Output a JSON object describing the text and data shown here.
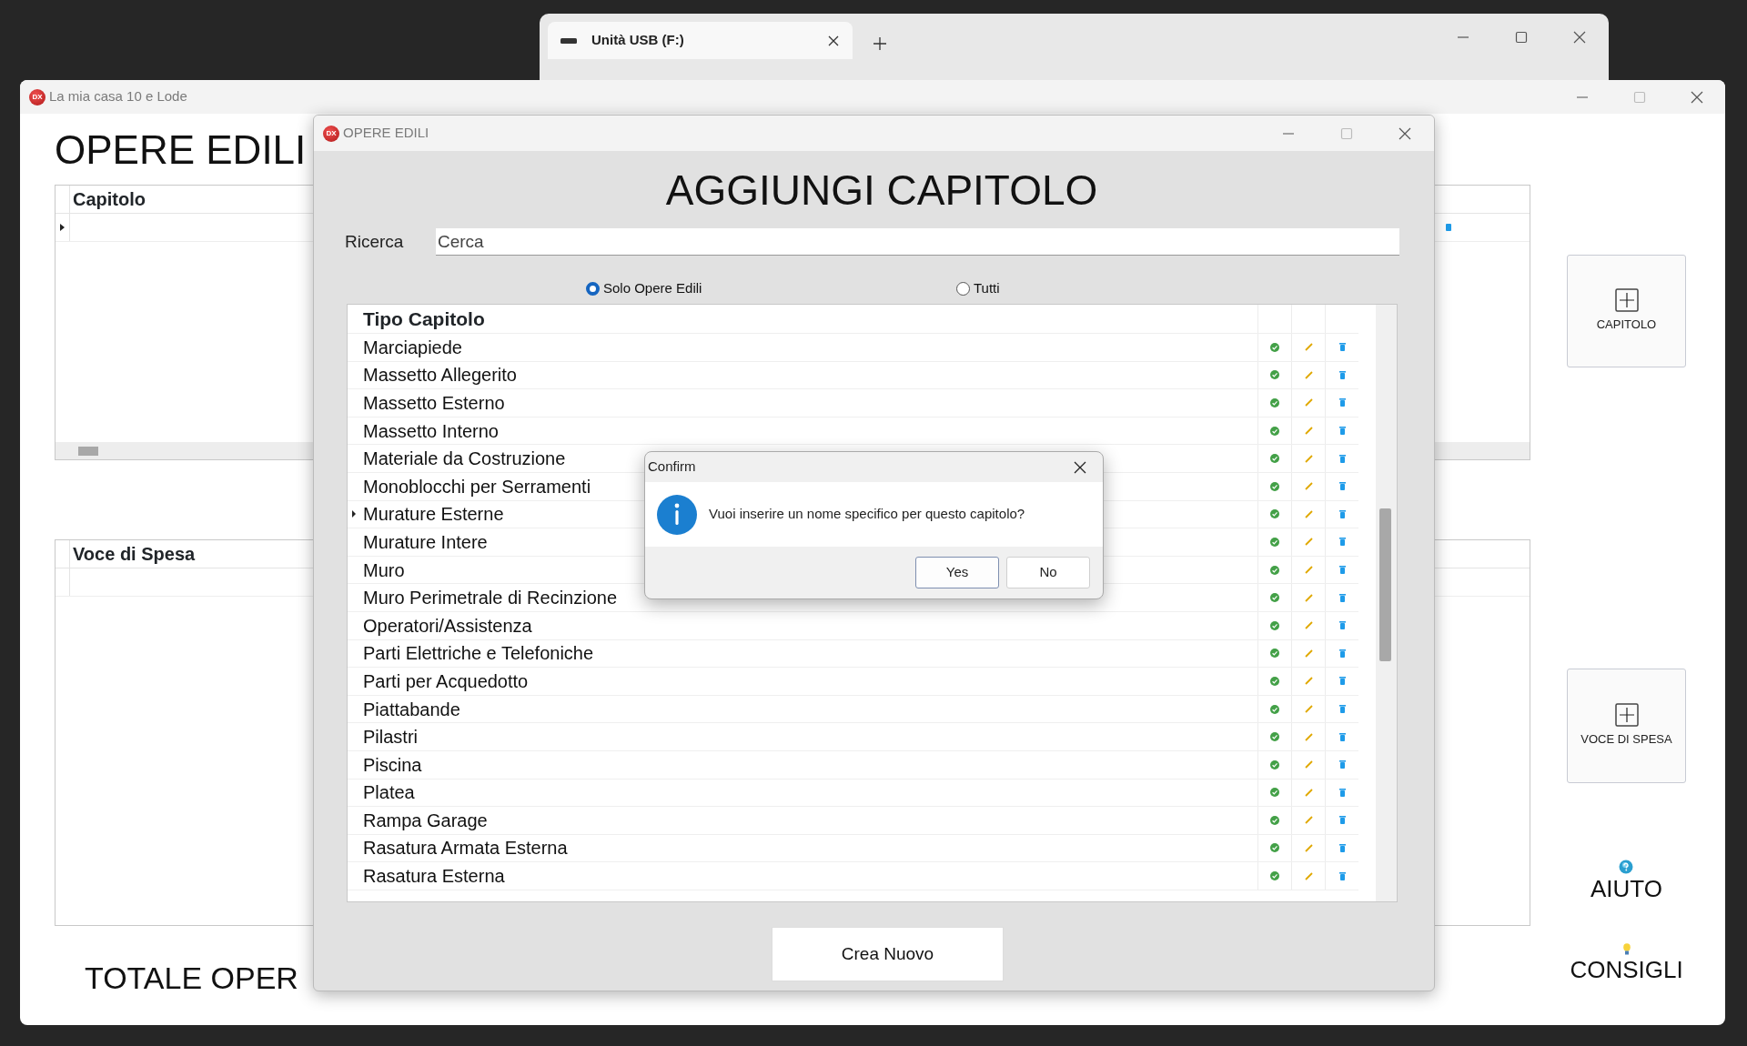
{
  "explorer_window": {
    "tab": {
      "title": "Unità USB (F:)"
    }
  },
  "main_window": {
    "logo": "DX",
    "title": "La mia casa 10 e Lode",
    "heading": "OPERE EDILI",
    "grids": [
      {
        "columns": [
          "Capitolo"
        ]
      },
      {
        "columns": [
          "Voce di Spesa"
        ]
      }
    ],
    "total": "TOTALE OPER",
    "buttons": [
      {
        "label": "CAPITOLO"
      },
      {
        "label": "VOCE DI SPESA"
      }
    ],
    "links": [
      {
        "kind": "help",
        "label": "AIUTO"
      },
      {
        "kind": "tips",
        "label": "CONSIGLI"
      }
    ]
  },
  "dialog": {
    "logo": "DX",
    "title": "OPERE EDILI",
    "heading": "AGGIUNGI CAPITOLO",
    "search": {
      "label": "Ricerca",
      "placeholder": "Cerca"
    },
    "filters": [
      {
        "label": "Solo Opere Edili",
        "selected": true
      },
      {
        "label": "Tutti",
        "selected": false
      }
    ],
    "table": {
      "columns": [
        "Tipo Capitolo"
      ],
      "rows": [
        {
          "name": "Marciapiede",
          "selected": false
        },
        {
          "name": "Massetto Allegerito",
          "selected": false
        },
        {
          "name": "Massetto Esterno",
          "selected": false
        },
        {
          "name": "Massetto Interno",
          "selected": false
        },
        {
          "name": "Materiale da Costruzione",
          "selected": false
        },
        {
          "name": "Monoblocchi per Serramenti",
          "selected": false
        },
        {
          "name": "Murature Esterne",
          "selected": true
        },
        {
          "name": "Murature Intere",
          "selected": false
        },
        {
          "name": "Muro",
          "selected": false
        },
        {
          "name": "Muro Perimetrale di Recinzione",
          "selected": false
        },
        {
          "name": "Operatori/Assistenza",
          "selected": false
        },
        {
          "name": "Parti Elettriche e Telefoniche",
          "selected": false
        },
        {
          "name": "Parti per Acquedotto",
          "selected": false
        },
        {
          "name": "Piattabande",
          "selected": false
        },
        {
          "name": "Pilastri",
          "selected": false
        },
        {
          "name": "Piscina",
          "selected": false
        },
        {
          "name": "Platea",
          "selected": false
        },
        {
          "name": "Rampa Garage",
          "selected": false
        },
        {
          "name": "Rasatura Armata Esterna",
          "selected": false
        },
        {
          "name": "Rasatura Esterna",
          "selected": false
        }
      ]
    },
    "create_button": "Crea Nuovo"
  },
  "confirm": {
    "title": "Confirm",
    "message": "Vuoi inserire un nome specifico per questo capitolo?",
    "buttons": [
      {
        "label": "Yes",
        "default": true
      },
      {
        "label": "No",
        "default": false
      }
    ]
  }
}
